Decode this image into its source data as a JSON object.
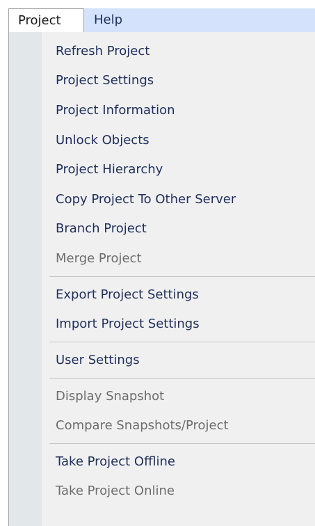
{
  "menubar": {
    "items": [
      {
        "label": "Project"
      },
      {
        "label": "Help"
      }
    ]
  },
  "menu": {
    "items": [
      {
        "label": "Refresh Project",
        "enabled": true
      },
      {
        "label": "Project Settings",
        "enabled": true
      },
      {
        "label": "Project Information",
        "enabled": true
      },
      {
        "label": "Unlock Objects",
        "enabled": true
      },
      {
        "label": "Project Hierarchy",
        "enabled": true
      },
      {
        "label": "Copy Project To Other Server",
        "enabled": true
      },
      {
        "label": "Branch Project",
        "enabled": true
      },
      {
        "label": "Merge Project",
        "enabled": false
      },
      {
        "label": "Export Project Settings",
        "enabled": true
      },
      {
        "label": "Import Project Settings",
        "enabled": true
      },
      {
        "label": "User Settings",
        "enabled": true
      },
      {
        "label": "Display Snapshot",
        "enabled": false
      },
      {
        "label": "Compare Snapshots/Project",
        "enabled": false
      },
      {
        "label": "Take Project Offline",
        "enabled": true
      },
      {
        "label": "Take Project Online",
        "enabled": false
      }
    ]
  }
}
